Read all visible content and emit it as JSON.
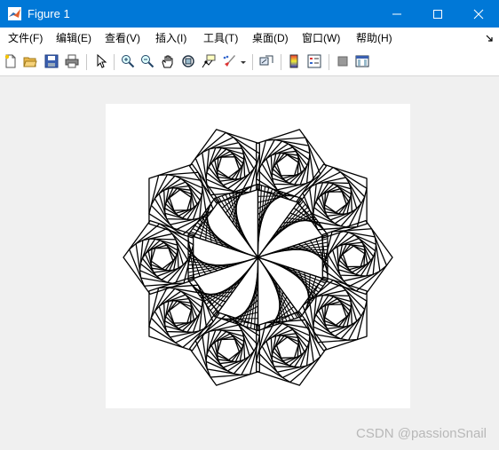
{
  "window": {
    "title": "Figure 1"
  },
  "menu": [
    "文件(F)",
    "编辑(E)",
    "查看(V)",
    "插入(I)",
    "工具(T)",
    "桌面(D)",
    "窗口(W)",
    "帮助(H)"
  ],
  "toolbar": {
    "icons": [
      "new-figure-icon",
      "open-file-icon",
      "save-icon",
      "print-icon",
      "edit-plot-icon",
      "zoom-in-icon",
      "zoom-out-icon",
      "pan-icon",
      "rotate-3d-icon",
      "data-cursor-icon",
      "brush-icon",
      "brush-dropdown-icon",
      "link-plot-icon",
      "insert-colorbar-icon",
      "insert-legend-icon",
      "hide-plot-tools-icon",
      "show-plot-tools-icon"
    ]
  },
  "figure": {
    "petals": 10,
    "outer_rings": 10,
    "inner_lines_per_sector": 12,
    "line_color": "#000000"
  },
  "watermark": "CSDN @passionSnail",
  "colors": {
    "titlebar": "#0078d7",
    "background": "#f0f0f0"
  }
}
